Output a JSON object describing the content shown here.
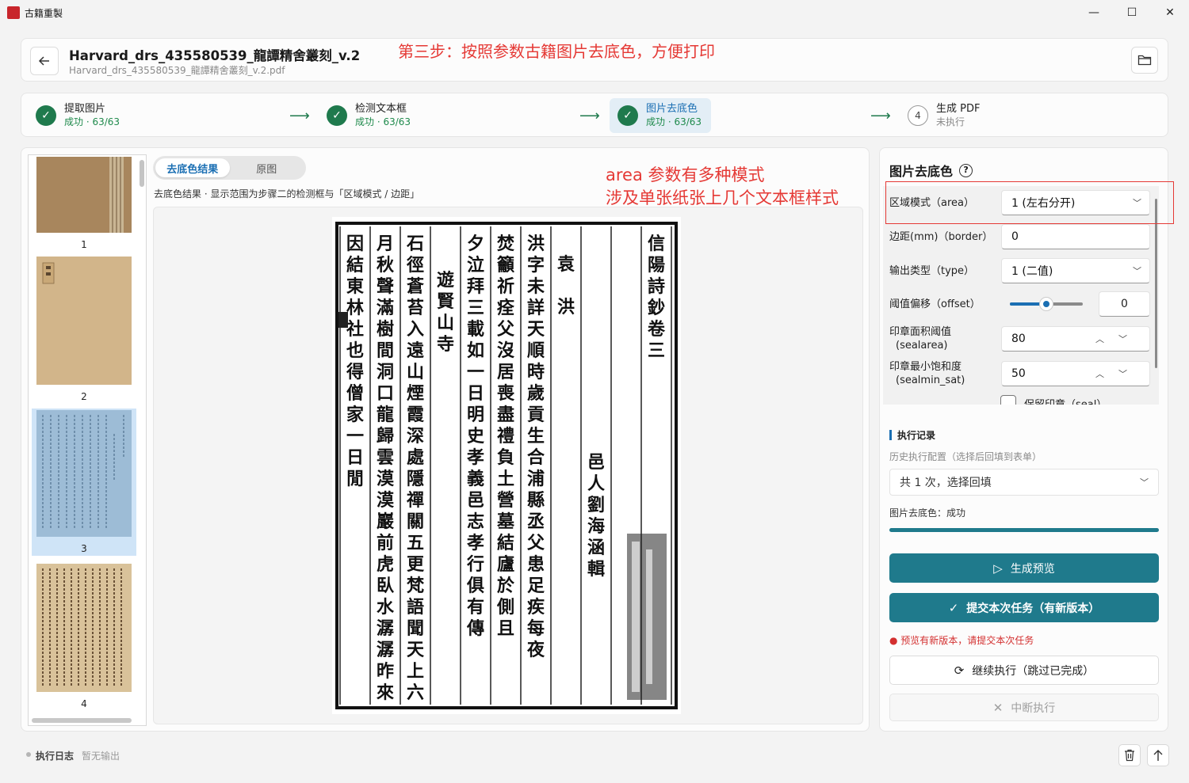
{
  "window": {
    "title": "古籍重製",
    "icon_text": "古籍"
  },
  "header": {
    "title": "Harvard_drs_435580539_龍譚精舍叢刻_v.2",
    "filename": "Harvard_drs_435580539_龍譚精舍叢刻_v.2.pdf",
    "annotation": "第三步：按照参数古籍图片去底色，方便打印"
  },
  "steps": [
    {
      "num": "1",
      "name": "提取图片",
      "status": "成功 · 63/63",
      "done": true
    },
    {
      "num": "2",
      "name": "检测文本框",
      "status": "成功 · 63/63",
      "done": true
    },
    {
      "num": "3",
      "name": "图片去底色",
      "status": "成功 · 63/63",
      "done": true
    },
    {
      "num": "4",
      "name": "生成 PDF",
      "status": "未执行",
      "done": false
    }
  ],
  "thumbnails": [
    {
      "num": "1"
    },
    {
      "num": "2"
    },
    {
      "num": "3"
    },
    {
      "num": "4"
    }
  ],
  "viewer": {
    "tabs": [
      "去底色结果",
      "原图"
    ],
    "caption": "去底色结果 · 显示范围为步骤二的检测框与「区域模式 / 边距」",
    "annotation_line1": "area 参数有多种模式",
    "annotation_line2": "涉及单张纸张上几个文本框样式",
    "page_columns": [
      "信陽詩鈔卷三",
      "",
      "邑人劉海涵輯",
      "袁　洪",
      "洪字未詳天順時歲貢生合浦縣丞父患足疾每夜",
      "焚籲祈痊父沒居喪盡禮負土營墓結廬於側且",
      "夕泣拜三載如一日明史孝義邑志孝行俱有傳",
      "遊賢山寺",
      "石徑蒼苔入遠山煙霞深處隱禪關五更梵語聞天上六",
      "月秋聲滿樹間洞口龍歸雲漠漠巖前虎臥水潺潺昨來",
      "因結東林社也得僧家一日閒"
    ]
  },
  "panel": {
    "title": "图片去底色",
    "fields": {
      "area_label": "区域模式（area）",
      "area_value": "1 (左右分开)",
      "border_label": "边距(mm)（border）",
      "border_value": "0",
      "type_label": "输出类型（type）",
      "type_value": "1 (二值)",
      "offset_label": "阈值偏移（offset）",
      "offset_value": "0",
      "sealarea_label_1": "印章面积阈值",
      "sealarea_label_2": "(sealarea)",
      "sealarea_value": "80",
      "sealmin_label_1": "印章最小饱和度",
      "sealmin_label_2": "(sealmin_sat)",
      "sealmin_value": "50",
      "seal_label": "保留印章（seal）"
    },
    "history": {
      "title": "执行记录",
      "subtitle": "历史执行配置（选择后回填到表单）",
      "select_value": "共 1 次，选择回填",
      "status": "图片去底色：成功",
      "progress": 1.0
    },
    "buttons": {
      "preview": "生成预览",
      "submit": "提交本次任务（有新版本）",
      "warning": "预览有新版本，请提交本次任务",
      "continue": "继续执行（跳过已完成）",
      "abort": "中断执行"
    }
  },
  "footer": {
    "label": "执行日志",
    "empty": "暂无输出"
  },
  "colors": {
    "accent": "#1f7a8c",
    "success": "#1f7a4d",
    "annotation": "#e53935",
    "link": "#1b6fb3"
  }
}
